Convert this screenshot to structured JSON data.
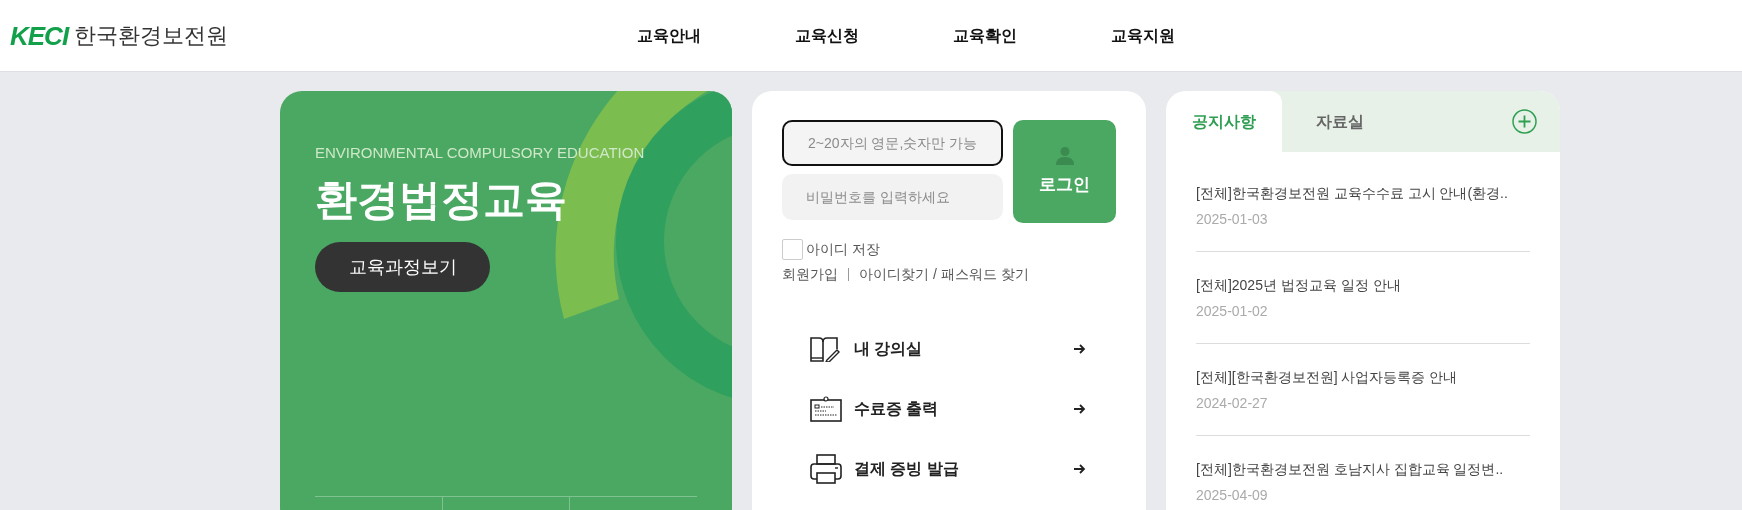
{
  "header": {
    "logo_mark": "KECI",
    "org_name": "한국환경보전원",
    "nav": [
      "교육안내",
      "교육신청",
      "교육확인",
      "교육지원"
    ]
  },
  "hero": {
    "subtitle": "ENVIRONMENTAL COMPULSORY EDUCATION",
    "title": "환경법정교육",
    "button": "교육과정보기"
  },
  "login": {
    "id_placeholder": "2~20자의 영문,숫자만 가능",
    "password_placeholder": "비밀번호를 입력하세요",
    "login_button": "로그인",
    "remember": {
      "label": "아이디 저장",
      "checked": false
    },
    "links": [
      "회원가입",
      "아이디찾기 / 패스워드 찾기"
    ],
    "quick_links": [
      {
        "kind": "book",
        "label": "내 강의실"
      },
      {
        "kind": "certificate",
        "label": "수료증 출력"
      },
      {
        "kind": "printer",
        "label": "결제 증빙 발급"
      }
    ]
  },
  "board": {
    "tabs": [
      {
        "label": "공지사항",
        "selected": true
      },
      {
        "label": "자료실",
        "selected": false
      }
    ],
    "items": [
      {
        "title": "[전체]한국환경보전원 교육수수료 고시 안내(환경..",
        "date": "2025-01-03"
      },
      {
        "title": "[전체]2025년 법정교육 일정 안내",
        "date": "2025-01-02"
      },
      {
        "title": "[전체][한국환경보전원] 사업자등록증 안내",
        "date": "2024-02-27"
      },
      {
        "title": "[전체]한국환경보전원 호남지사 집합교육 일정변..",
        "date": "2025-04-09"
      }
    ]
  }
}
